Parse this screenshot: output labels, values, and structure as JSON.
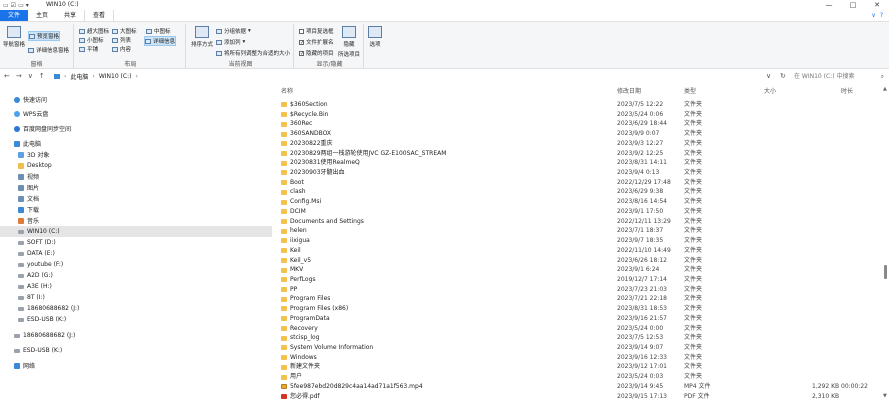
{
  "titlebar": {
    "title": "WIN10 (C:)",
    "controls": [
      "—",
      "□",
      "✕"
    ]
  },
  "tabs": {
    "items": [
      "文件",
      "主页",
      "共享",
      "查看"
    ],
    "active_index": 3
  },
  "ribbon": {
    "groups": {
      "pane": {
        "label": "窗格",
        "nav_pane": "导航窗格",
        "preview": "预览窗格",
        "details": "详细信息窗格"
      },
      "layout": {
        "label": "布局",
        "items": [
          "超大图标",
          "大图标",
          "中图标",
          "小图标",
          "列表",
          "详细信息",
          "平铺",
          "内容"
        ]
      },
      "current_view": {
        "label": "当前视图",
        "sort": "排序方式",
        "group_by": "分组依据",
        "add_column": "添加列",
        "fit_columns": "将所有列调整为合适的大小"
      },
      "show_hide": {
        "label": "显示/隐藏",
        "item_checkbox": "项目复选框",
        "file_ext": "文件扩展名",
        "hidden_items": "隐藏的项目",
        "hide_selected": "隐藏",
        "hide_selected_2": "所选项目"
      },
      "options": {
        "label": "选项"
      }
    }
  },
  "address": {
    "path": [
      "此电脑",
      "WIN10 (C:)"
    ],
    "search_placeholder": "在 WIN10 (C:) 中搜索"
  },
  "nav": {
    "items": [
      {
        "label": "快速访问",
        "icon": "star-icon",
        "indent": 14
      },
      {
        "label": "WPS云盘",
        "icon": "cloud-icon",
        "indent": 14
      },
      {
        "label": "百度网盘同步空间",
        "icon": "baidu-icon",
        "indent": 14
      },
      {
        "label": "此电脑",
        "icon": "pc-icon",
        "indent": 14
      },
      {
        "label": "3D 对象",
        "icon": "obj-icon",
        "indent": 18
      },
      {
        "label": "Desktop",
        "icon": "folder-icon",
        "indent": 18
      },
      {
        "label": "视频",
        "icon": "doc-icon",
        "indent": 18
      },
      {
        "label": "图片",
        "icon": "doc-icon",
        "indent": 18
      },
      {
        "label": "文档",
        "icon": "doc-icon",
        "indent": 18
      },
      {
        "label": "下载",
        "icon": "download-icon",
        "indent": 18
      },
      {
        "label": "音乐",
        "icon": "music-icon",
        "indent": 18
      },
      {
        "label": "WIN10 (C:)",
        "icon": "drive-icon",
        "indent": 18,
        "selected": true
      },
      {
        "label": "SOFT (D:)",
        "icon": "drive-icon",
        "indent": 18
      },
      {
        "label": "DATA (E:)",
        "icon": "drive-icon",
        "indent": 18
      },
      {
        "label": "youtube (F:)",
        "icon": "drive-icon",
        "indent": 18
      },
      {
        "label": "A2D (G:)",
        "icon": "drive-icon",
        "indent": 18
      },
      {
        "label": "A3E (H:)",
        "icon": "drive-icon",
        "indent": 18
      },
      {
        "label": "8T (I:)",
        "icon": "drive-icon",
        "indent": 18
      },
      {
        "label": "18680688682 (J:)",
        "icon": "drive-icon",
        "indent": 18
      },
      {
        "label": "ESD-USB (K:)",
        "icon": "drive-icon",
        "indent": 18
      },
      {
        "label": "18680688682 (J:)",
        "icon": "drive-icon",
        "indent": 14
      },
      {
        "label": "ESD-USB (K:)",
        "icon": "drive-icon",
        "indent": 14
      },
      {
        "label": "网络",
        "icon": "network-icon",
        "indent": 14
      }
    ]
  },
  "filelist": {
    "headers": {
      "name": "名称",
      "date": "修改日期",
      "type": "类型",
      "size": "大小",
      "duration": "时长"
    },
    "rows": [
      {
        "name": "$360Section",
        "date": "2023/7/5 12:22",
        "type": "文件夹",
        "icon": "folder"
      },
      {
        "name": "$Recycle.Bin",
        "date": "2023/5/24 0:06",
        "type": "文件夹",
        "icon": "folder"
      },
      {
        "name": "360Rec",
        "date": "2023/6/29 18:44",
        "type": "文件夹",
        "icon": "folder"
      },
      {
        "name": "360SANDBOX",
        "date": "2023/9/9 0:07",
        "type": "文件夹",
        "icon": "folder"
      },
      {
        "name": "20230822重庆",
        "date": "2023/9/3 12:27",
        "type": "文件夹",
        "icon": "folder"
      },
      {
        "name": "20230829两组一栈游轮使用JVC GZ-E100SAC_STREAM",
        "date": "2023/9/2 12:25",
        "type": "文件夹",
        "icon": "folder"
      },
      {
        "name": "20230831使用RealmeQ",
        "date": "2023/8/31 14:11",
        "type": "文件夹",
        "icon": "folder"
      },
      {
        "name": "20230903牙髓出血",
        "date": "2023/9/4 0:13",
        "type": "文件夹",
        "icon": "folder"
      },
      {
        "name": "Boot",
        "date": "2022/12/29 17:48",
        "type": "文件夹",
        "icon": "folder"
      },
      {
        "name": "clash",
        "date": "2023/6/29 9:38",
        "type": "文件夹",
        "icon": "folder"
      },
      {
        "name": "Config.Msi",
        "date": "2023/8/16 14:54",
        "type": "文件夹",
        "icon": "folder"
      },
      {
        "name": "DCIM",
        "date": "2023/9/1 17:50",
        "type": "文件夹",
        "icon": "folder"
      },
      {
        "name": "Documents and Settings",
        "date": "2022/12/11 13:29",
        "type": "文件夹",
        "icon": "folder"
      },
      {
        "name": "helen",
        "date": "2023/7/1 18:37",
        "type": "文件夹",
        "icon": "folder"
      },
      {
        "name": "iixigua",
        "date": "2023/9/7 18:35",
        "type": "文件夹",
        "icon": "folder"
      },
      {
        "name": "Keil",
        "date": "2022/11/10 14:49",
        "type": "文件夹",
        "icon": "folder"
      },
      {
        "name": "Keil_v5",
        "date": "2023/6/26 18:12",
        "type": "文件夹",
        "icon": "folder"
      },
      {
        "name": "MKV",
        "date": "2023/9/1 6:24",
        "type": "文件夹",
        "icon": "folder"
      },
      {
        "name": "PerfLogs",
        "date": "2019/12/7 17:14",
        "type": "文件夹",
        "icon": "folder"
      },
      {
        "name": "PP",
        "date": "2023/7/23 21:03",
        "type": "文件夹",
        "icon": "folder"
      },
      {
        "name": "Program Files",
        "date": "2023/7/21 22:18",
        "type": "文件夹",
        "icon": "folder"
      },
      {
        "name": "Program Files (x86)",
        "date": "2023/8/31 18:53",
        "type": "文件夹",
        "icon": "folder"
      },
      {
        "name": "ProgramData",
        "date": "2023/9/16 21:57",
        "type": "文件夹",
        "icon": "folder"
      },
      {
        "name": "Recovery",
        "date": "2023/5/24 0:00",
        "type": "文件夹",
        "icon": "folder"
      },
      {
        "name": "stcisp_log",
        "date": "2023/7/5 12:53",
        "type": "文件夹",
        "icon": "folder"
      },
      {
        "name": "System Volume Information",
        "date": "2023/9/14 9:07",
        "type": "文件夹",
        "icon": "folder"
      },
      {
        "name": "Windows",
        "date": "2023/9/16 12:33",
        "type": "文件夹",
        "icon": "folder"
      },
      {
        "name": "新建文件夹",
        "date": "2023/9/12 17:01",
        "type": "文件夹",
        "icon": "folder"
      },
      {
        "name": "用户",
        "date": "2023/5/24 0:03",
        "type": "文件夹",
        "icon": "folder"
      },
      {
        "name": "5fee987ebd20d829c4aa14ad71a1f563.mp4",
        "date": "2023/9/14 9:45",
        "type": "MP4 文件",
        "size": "1,292 KB",
        "duration": "00:00:22",
        "icon": "mp4"
      },
      {
        "name": "您必得.pdf",
        "date": "2023/9/15 17:13",
        "type": "PDF 文件",
        "size": "2,310 KB",
        "icon": "pdf"
      }
    ]
  }
}
